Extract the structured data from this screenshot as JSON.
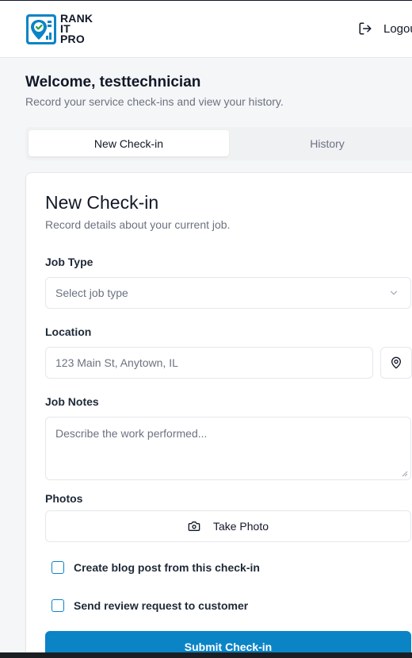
{
  "brand": {
    "logo_lines": [
      "RANK",
      "IT",
      "PRO"
    ],
    "logout_label": "Logout"
  },
  "welcome": {
    "title": "Welcome, testtechnician",
    "subtitle": "Record your service check-ins and view your history."
  },
  "tabs": [
    {
      "label": "New Check-in",
      "active": true
    },
    {
      "label": "History",
      "active": false
    }
  ],
  "form": {
    "title": "New Check-in",
    "description": "Record details about your current job.",
    "job_type": {
      "label": "Job Type",
      "placeholder": "Select job type"
    },
    "location": {
      "label": "Location",
      "placeholder": "123 Main St, Anytown, IL"
    },
    "notes": {
      "label": "Job Notes",
      "placeholder": "Describe the work performed..."
    },
    "photos": {
      "label": "Photos",
      "button_label": "Take Photo"
    },
    "checkboxes": [
      {
        "label": "Create blog post from this check-in",
        "checked": false
      },
      {
        "label": "Send review request to customer",
        "checked": false
      }
    ],
    "submit_label": "Submit Check-in"
  },
  "icons": {
    "logo": "location-pin-check-icon",
    "logout": "logout-icon",
    "select": "chevron-down-icon",
    "location": "map-pin-icon",
    "camera": "camera-icon"
  },
  "colors": {
    "primary": "#0b84c6",
    "logo_blue": "#0b84c6",
    "logo_green": "#22a447"
  }
}
